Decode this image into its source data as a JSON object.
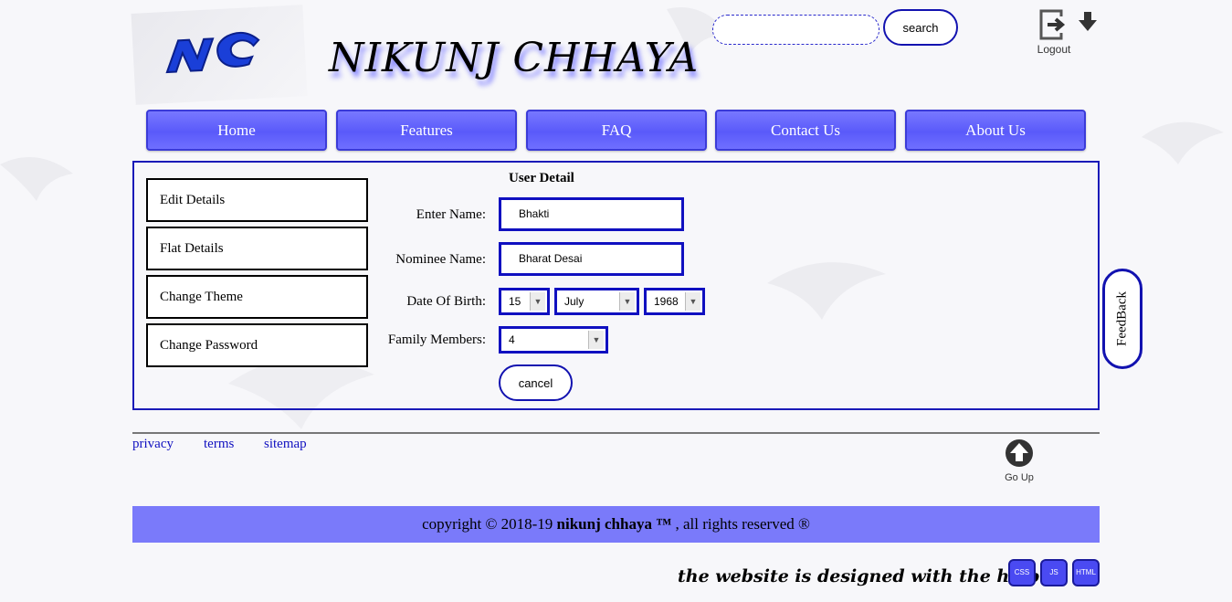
{
  "header": {
    "logo_text": "NC",
    "site_title": "NIKUNJ CHHAYA",
    "search": {
      "value": "",
      "button_label": "search"
    },
    "logout_label": "Logout"
  },
  "nav": {
    "items": [
      {
        "label": "Home"
      },
      {
        "label": "Features"
      },
      {
        "label": "FAQ"
      },
      {
        "label": "Contact Us"
      },
      {
        "label": "About Us"
      }
    ]
  },
  "sidebar": {
    "items": [
      {
        "label": "Edit Details"
      },
      {
        "label": "Flat Details"
      },
      {
        "label": "Change Theme"
      },
      {
        "label": "Change Password"
      }
    ]
  },
  "form": {
    "heading": "User Detail",
    "name": {
      "label": "Enter Name:",
      "value": "Bhakti"
    },
    "nominee": {
      "label": "Nominee Name:",
      "value": "Bharat Desai"
    },
    "dob": {
      "label": "Date Of Birth:",
      "day": "15",
      "month": "July",
      "year": "1968"
    },
    "family": {
      "label": "Family Members:",
      "value": "4"
    },
    "cancel_label": "cancel"
  },
  "feedback_label": "FeedBack",
  "footer": {
    "links": [
      {
        "label": "privacy"
      },
      {
        "label": "terms"
      },
      {
        "label": "sitemap"
      }
    ],
    "go_up_label": "Go Up",
    "copyright_prefix": "copyright © 2018-19 ",
    "copyright_brand": "nikunj chhaya ™",
    "copyright_suffix": " , all rights reserved ®",
    "credit_text": "the website is designed with the help of",
    "tech_badges": [
      "CSS",
      "JS",
      "HTML"
    ]
  },
  "colors": {
    "accent": "#5a5afa",
    "border": "#1010c0",
    "copyright_bg": "#7a7afa"
  }
}
